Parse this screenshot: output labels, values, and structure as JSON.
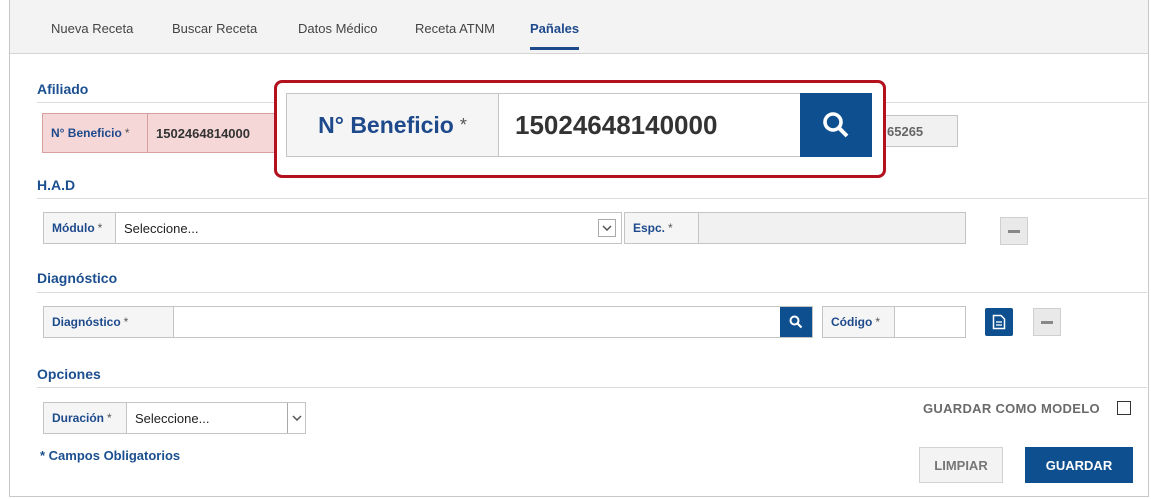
{
  "tabs": [
    {
      "label": "Nueva Receta"
    },
    {
      "label": "Buscar Receta"
    },
    {
      "label": "Datos Médico"
    },
    {
      "label": "Receta ATNM"
    },
    {
      "label": "Pañales"
    }
  ],
  "active_tab": "Pañales",
  "afiliado": {
    "title": "Afiliado",
    "beneficio_label": "N° Beneficio",
    "required_mark": "*",
    "beneficio_value": "1502464814000",
    "other_value": "65265"
  },
  "zoom": {
    "label": "N° Beneficio",
    "required_mark": "*",
    "value": "15024648140000"
  },
  "had": {
    "title": "H.A.D",
    "modulo_label": "Módulo",
    "modulo_value": "Seleccione...",
    "espc_label": "Espc.",
    "espc_value": ""
  },
  "diagnostico": {
    "title": "Diagnóstico",
    "diag_label": "Diagnóstico",
    "diag_value": "",
    "codigo_label": "Código",
    "codigo_value": ""
  },
  "opciones": {
    "title": "Opciones",
    "duracion_label": "Duración",
    "duracion_value": "Seleccione...",
    "guardar_modelo_label": "GUARDAR COMO MODELO",
    "guardar_modelo_checked": false
  },
  "footer": {
    "required_note": "* Campos Obligatorios",
    "limpiar_label": "LIMPIAR",
    "guardar_label": "GUARDAR"
  },
  "colors": {
    "brand_blue": "#0e4f8f",
    "section_blue": "#1b4f8f",
    "highlight_red": "#b3111d",
    "highlight_bg": "#f6d7d7"
  }
}
